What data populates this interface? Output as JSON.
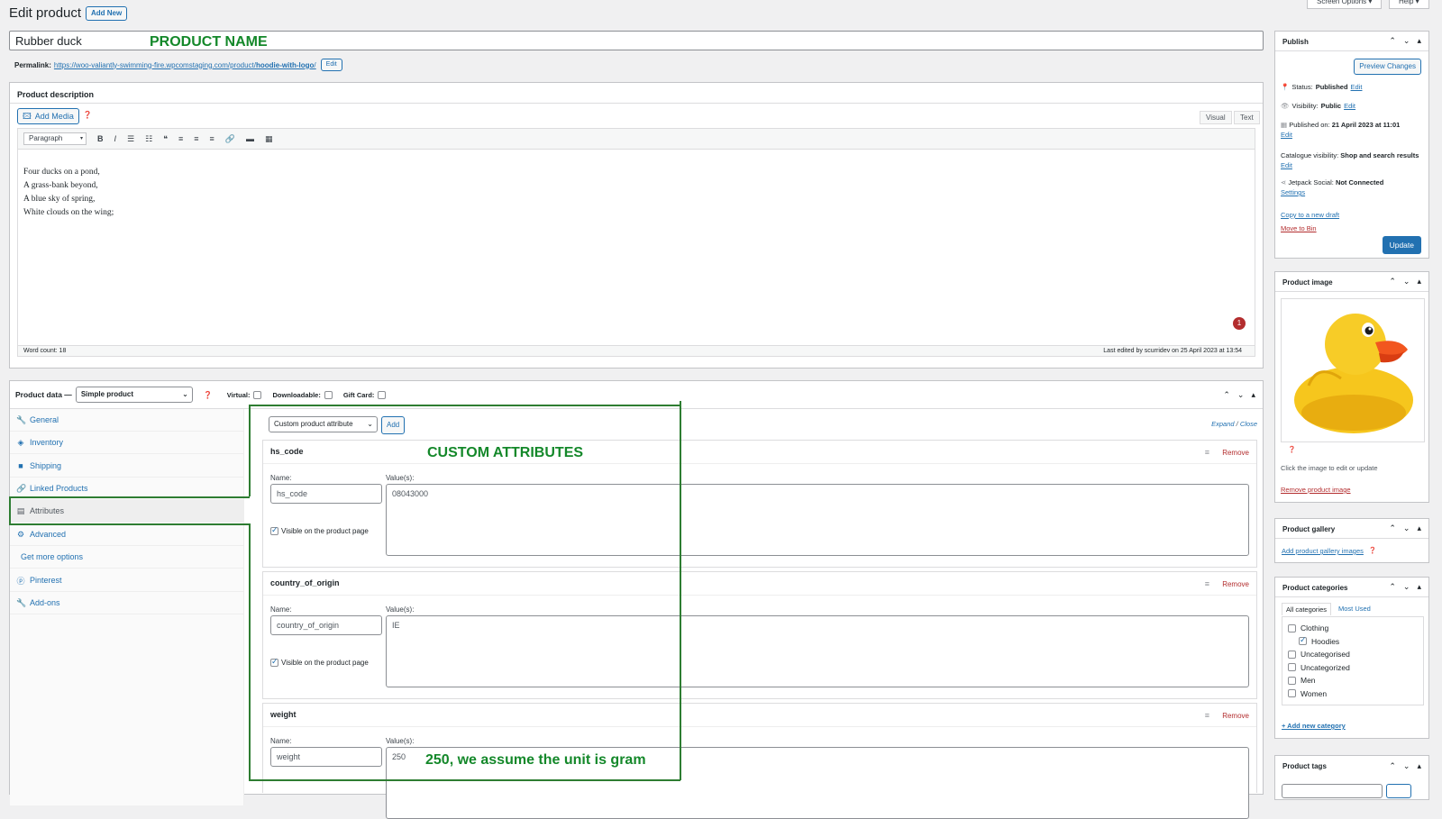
{
  "page": {
    "title": "Edit product",
    "add_new": "Add New",
    "screen_options": "Screen Options ▾",
    "help": "Help ▾"
  },
  "product": {
    "name": "Rubber duck",
    "permalink_label": "Permalink:",
    "permalink_base": "https://woo-valiantly-swimming-fire.wpcomstaging.com/product/",
    "permalink_slug": "hoodie-with-logo",
    "permalink_tail": "/",
    "permalink_edit": "Edit"
  },
  "annotations": {
    "product_name": "PRODUCT NAME",
    "custom_attributes": "CUSTOM ATTRIBUTES",
    "weight_note": "250, we assume the unit is gram"
  },
  "description": {
    "title": "Product description",
    "add_media": "Add Media",
    "tab_visual": "Visual",
    "tab_text": "Text",
    "format_select": "Paragraph",
    "lines": [
      "Four ducks on a pond,",
      "A grass-bank beyond,",
      "A blue sky of spring,",
      "White clouds on the wing;"
    ],
    "word_count": "Word count: 18",
    "last_edited": "Last edited by scurridev on 25 April 2023 at 13:54",
    "notice_count": "1"
  },
  "product_data": {
    "label": "Product data —",
    "type_select": "Simple product",
    "virtual_label": "Virtual:",
    "downloadable_label": "Downloadable:",
    "gift_card_label": "Gift Card:",
    "tabs": [
      {
        "label": "General",
        "icon": "wrench-icon"
      },
      {
        "label": "Inventory",
        "icon": "tag-icon"
      },
      {
        "label": "Shipping",
        "icon": "truck-icon"
      },
      {
        "label": "Linked Products",
        "icon": "link-icon"
      },
      {
        "label": "Attributes",
        "icon": "table-icon"
      },
      {
        "label": "Advanced",
        "icon": "gear-icon"
      },
      {
        "label": "Get more options",
        "icon": ""
      },
      {
        "label": "Pinterest",
        "icon": "pinterest-icon"
      },
      {
        "label": "Add-ons",
        "icon": "wrench-icon"
      }
    ],
    "attr_select": "Custom product attribute",
    "attr_add": "Add",
    "expand": "Expand",
    "expand_sep": " / ",
    "close": "Close",
    "name_label": "Name:",
    "values_label": "Value(s):",
    "visible_label": "Visible on the product page",
    "remove_label": "Remove",
    "attributes": [
      {
        "title": "hs_code",
        "name": "hs_code",
        "value": "08043000"
      },
      {
        "title": "country_of_origin",
        "name": "country_of_origin",
        "value": "IE"
      },
      {
        "title": "weight",
        "name": "weight",
        "value": "250"
      }
    ]
  },
  "publish": {
    "title": "Publish",
    "preview": "Preview Changes",
    "status_label": "Status:",
    "status_value": "Published",
    "visibility_label": "Visibility:",
    "visibility_value": "Public",
    "published_label": "Published on:",
    "published_value": "21 April 2023 at 11:01",
    "catalogue_label": "Catalogue visibility:",
    "catalogue_value": "Shop and search results",
    "jetpack_label": "Jetpack Social:",
    "jetpack_value": "Not Connected",
    "settings": "Settings",
    "edit": "Edit",
    "copy_draft": "Copy to a new draft",
    "move_bin": "Move to Bin",
    "update": "Update"
  },
  "product_image": {
    "title": "Product image",
    "hint": "Click the image to edit or update",
    "remove": "Remove product image"
  },
  "gallery": {
    "title": "Product gallery",
    "add": "Add product gallery images"
  },
  "categories": {
    "title": "Product categories",
    "tab_all": "All categories",
    "tab_used": "Most Used",
    "items": [
      {
        "label": "Clothing",
        "checked": false,
        "child": false
      },
      {
        "label": "Hoodies",
        "checked": true,
        "child": true
      },
      {
        "label": "Uncategorised",
        "checked": false,
        "child": false
      },
      {
        "label": "Uncategorized",
        "checked": false,
        "child": false
      },
      {
        "label": "Men",
        "checked": false,
        "child": false
      },
      {
        "label": "Women",
        "checked": false,
        "child": false
      }
    ],
    "add_new": "+ Add new category"
  },
  "tags": {
    "title": "Product tags"
  },
  "colors": {
    "primary": "#2271b1",
    "annotation": "#14882a",
    "danger": "#b32d2e"
  }
}
